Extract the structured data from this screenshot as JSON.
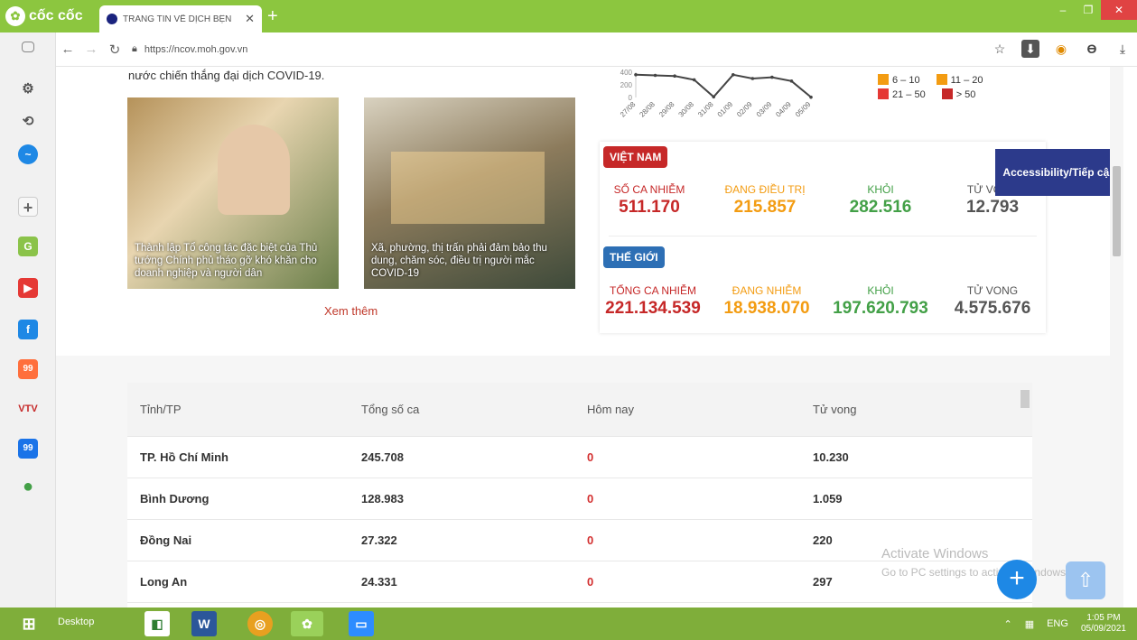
{
  "browser": {
    "brand": "cốc cốc",
    "tab_title": "TRANG TIN VỀ DỊCH BỆN",
    "url": "https://ncov.moh.gov.vn",
    "colors": {
      "chrome": "#8cc63f",
      "close": "#e04343"
    }
  },
  "page": {
    "intro_text": "nước chiến thắng đại dịch COVID-19.",
    "news": [
      {
        "caption": "Thành lập Tổ công tác đặc biệt của Thủ tướng Chính phủ tháo gỡ khó khăn cho doanh nghiệp và người dân"
      },
      {
        "caption": "Xã, phường, thị trấn phải đảm bảo thu dung, chăm sóc, điều trị người mắc COVID-19"
      }
    ],
    "xem_them": "Xem thêm",
    "accessibility_label": "Accessibility/Tiếp cận",
    "watermark_title": "Activate Windows",
    "watermark_sub": "Go to PC settings to activate Windows."
  },
  "chart_data": {
    "type": "line",
    "x": [
      "27/08",
      "28/08",
      "29/08",
      "30/08",
      "31/08",
      "01/09",
      "02/09",
      "03/09",
      "04/09",
      "05/09"
    ],
    "y_ticks": [
      "400",
      "200",
      "0"
    ],
    "values": [
      360,
      350,
      340,
      280,
      10,
      360,
      300,
      320,
      260,
      5
    ],
    "ylim": [
      0,
      400
    ]
  },
  "legend": [
    [
      {
        "label": "6 – 10",
        "color": "#f39c12"
      },
      {
        "label": "11 – 20",
        "color": "#f39c12"
      }
    ],
    [
      {
        "label": "21 – 50",
        "color": "#e53935"
      },
      {
        "label": "> 50",
        "color": "#c62828"
      }
    ]
  ],
  "vietnam": {
    "badge": "VIỆT NAM",
    "labels": {
      "cases": "SỐ CA NHIỄM",
      "treating": "ĐANG ĐIỀU TRỊ",
      "recovered": "KHỎI",
      "deaths": "TỬ VONG"
    },
    "values": {
      "cases": "511.170",
      "treating": "215.857",
      "recovered": "282.516",
      "deaths": "12.793"
    }
  },
  "world": {
    "badge": "THẾ GIỚI",
    "labels": {
      "cases": "TỔNG CA NHIỄM",
      "treating": "ĐANG NHIỄM",
      "recovered": "KHỎI",
      "deaths": "TỬ VONG"
    },
    "values": {
      "cases": "221.134.539",
      "treating": "18.938.070",
      "recovered": "197.620.793",
      "deaths": "4.575.676"
    }
  },
  "table": {
    "headers": [
      "Tỉnh/TP",
      "Tổng số ca",
      "Hôm nay",
      "Tử vong"
    ],
    "rows": [
      [
        "TP. Hồ Chí Minh",
        "245.708",
        "0",
        "10.230"
      ],
      [
        "Bình Dương",
        "128.983",
        "0",
        "1.059"
      ],
      [
        "Đồng Nai",
        "27.322",
        "0",
        "220"
      ],
      [
        "Long An",
        "24.331",
        "0",
        "297"
      ]
    ]
  },
  "taskbar": {
    "desktop": "Desktop",
    "lang": "ENG",
    "time": "1:05 PM",
    "date": "05/09/2021"
  }
}
